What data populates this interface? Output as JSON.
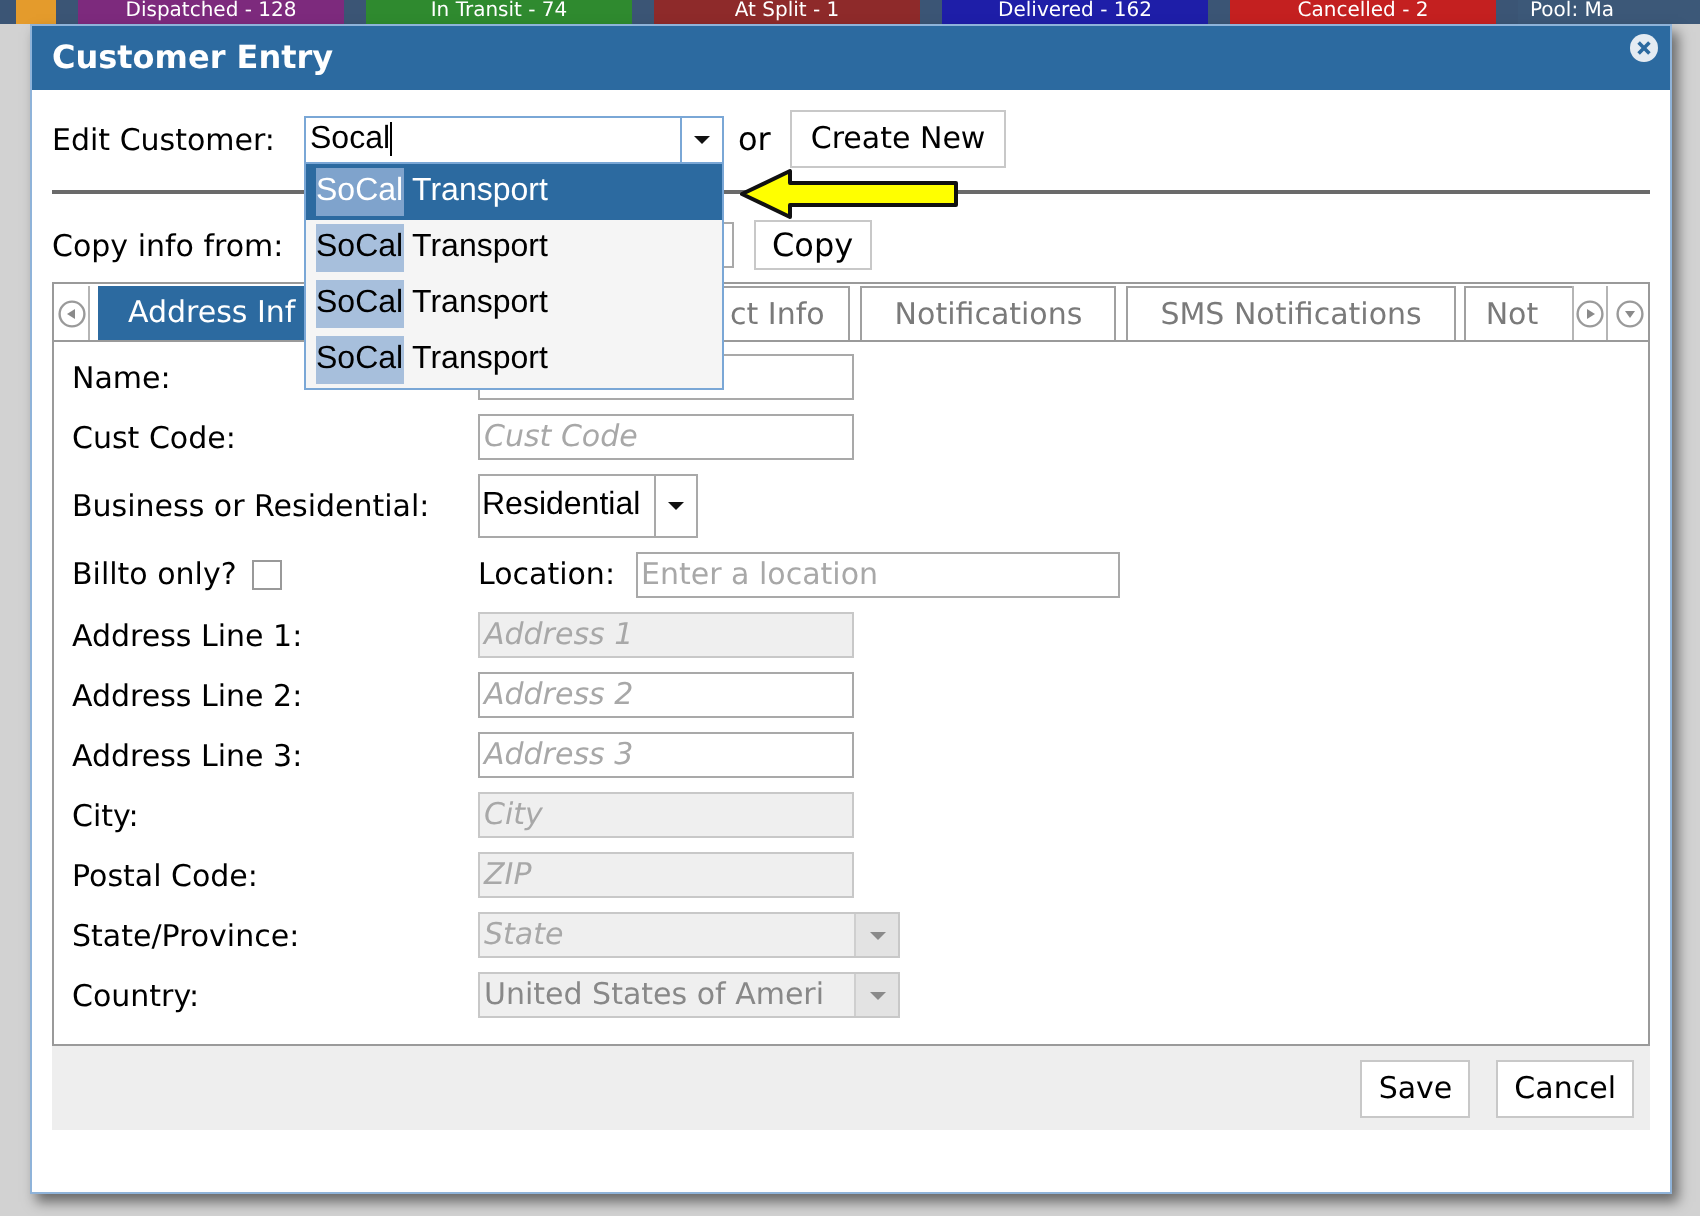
{
  "background_status_bar": [
    {
      "color": "#e49b2c"
    },
    {
      "label": "Dispatched - 128",
      "color": "#7d2a7d"
    },
    {
      "label": "In Transit - 74",
      "color": "#2f8a2f"
    },
    {
      "label": "At Split - 1",
      "color": "#8e2a2a"
    },
    {
      "label": "Delivered - 162",
      "color": "#1e1ea8"
    },
    {
      "label": "Cancelled - 2",
      "color": "#c42020"
    },
    {
      "label": "Pool: Ma",
      "color": "#3c5878"
    }
  ],
  "dialog": {
    "title": "Customer Entry",
    "edit_customer": {
      "label": "Edit Customer:",
      "value": "Socal",
      "expanded": true,
      "suggestions": [
        {
          "match": "SoCal",
          "rest": "Transport",
          "selected": true
        },
        {
          "match": "SoCal",
          "rest": "Transport",
          "selected": false
        },
        {
          "match": "SoCal",
          "rest": "Transport",
          "selected": false
        },
        {
          "match": "SoCal",
          "rest": "Transport",
          "selected": false
        }
      ],
      "separator": "or",
      "create_button": "Create New"
    },
    "copy_info": {
      "label": "Copy info from:",
      "button": "Copy"
    },
    "tabs": [
      {
        "label": "Address Inf",
        "selected": true
      },
      {
        "label": "ct Info",
        "selected": false
      },
      {
        "label": "Notifications",
        "selected": false
      },
      {
        "label": "SMS Notifications",
        "selected": false
      },
      {
        "label": "Not",
        "selected": false
      }
    ],
    "fields": [
      {
        "kind": "text",
        "label": "Name:",
        "disabled": false
      },
      {
        "kind": "text",
        "label": "Cust Code:",
        "placeholder": "Cust Code",
        "disabled": false
      },
      {
        "kind": "dropdown",
        "label": "Business or Residential:",
        "value": "Residential",
        "disabled": false
      },
      {
        "kind": "checkbox",
        "label": "Billto only?",
        "checked": false,
        "location": {
          "label": "Location:",
          "placeholder": "Enter a location"
        }
      },
      {
        "kind": "text",
        "label": "Address Line 1:",
        "placeholder": "Address 1",
        "disabled": true
      },
      {
        "kind": "text",
        "label": "Address Line 2:",
        "placeholder": "Address 2",
        "disabled": false
      },
      {
        "kind": "text",
        "label": "Address Line 3:",
        "placeholder": "Address 3",
        "disabled": false
      },
      {
        "kind": "text",
        "label": "City:",
        "placeholder": "City",
        "disabled": true
      },
      {
        "kind": "text",
        "label": "Postal Code:",
        "placeholder": "ZIP",
        "disabled": true
      },
      {
        "kind": "combobox",
        "label": "State/Province:",
        "placeholder": "State",
        "disabled": true
      },
      {
        "kind": "combobox",
        "label": "Country:",
        "value": "United States of Ameri",
        "disabled": true
      }
    ],
    "buttons": [
      "Save",
      "Cancel"
    ]
  }
}
